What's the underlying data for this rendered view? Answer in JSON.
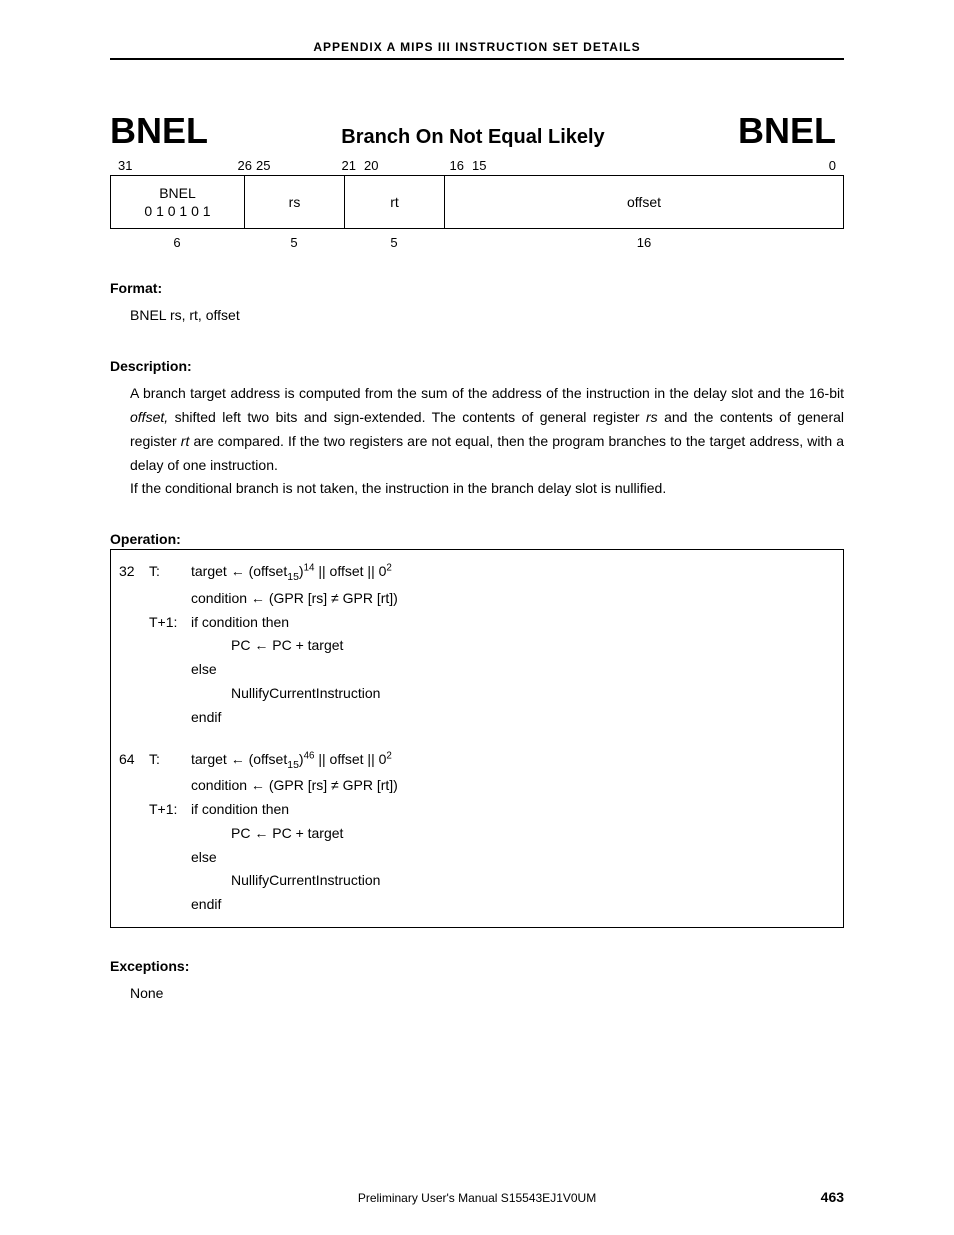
{
  "header": "APPENDIX  A   MIPS  III  INSTRUCTION  SET  DETAILS",
  "title": {
    "left": "BNEL",
    "center": "Branch On Not Equal Likely",
    "right": "BNEL"
  },
  "bits": {
    "c1_left": "31",
    "c1_right": "26",
    "c2_left": "25",
    "c2_right": "21",
    "c3_left": "20",
    "c3_right": "16",
    "c4_left": "15",
    "c4_right": "0"
  },
  "encoding": {
    "field1_line1": "BNEL",
    "field1_line2": "0 1 0 1 0 1",
    "field2": "rs",
    "field3": "rt",
    "field4": "offset",
    "width1": "6",
    "width2": "5",
    "width3": "5",
    "width4": "16"
  },
  "format": {
    "heading": "Format:",
    "body": "BNEL rs, rt, offset"
  },
  "description": {
    "heading": "Description:",
    "p1_a": "A branch target address is computed from the sum of the address of the instruction in the delay slot and the 16-bit ",
    "p1_offset": "offset,",
    "p1_b": " shifted left two bits and sign-extended.  The contents of general register ",
    "p1_rs": "rs",
    "p1_c": " and the contents of general register ",
    "p1_rt": "rt",
    "p1_d": " are compared.  If the two registers are not equal, then the program branches to the target address, with a delay of one instruction.",
    "p2": "If the conditional branch is not taken, the instruction in the branch delay slot is nullified."
  },
  "operation": {
    "heading": "Operation:",
    "mode32": "32",
    "mode64": "64",
    "t": "T:",
    "t1": "T+1:",
    "target_prefix": "target ← (offset",
    "target_sub": "15",
    "target_mid": ")",
    "target_sup32": "14",
    "target_sup64": "46",
    "target_suffix": " || offset || 0",
    "target_sq": "2",
    "cond": "condition ← (GPR [rs] ≠ GPR [rt])",
    "ifcond": "if condition then",
    "pc": "PC ← PC + target",
    "else": "else",
    "nullify": "NullifyCurrentInstruction",
    "endif": "endif"
  },
  "exceptions": {
    "heading": "Exceptions:",
    "body": "None"
  },
  "footer": {
    "center": "Preliminary User's Manual  S15543EJ1V0UM",
    "page": "463"
  }
}
